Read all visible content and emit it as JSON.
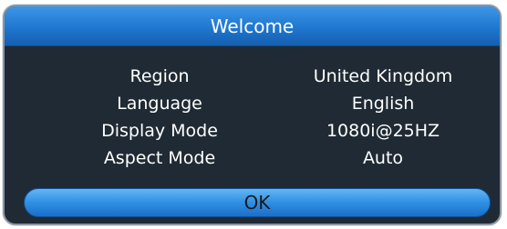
{
  "dialog": {
    "title": "Welcome",
    "settings": [
      {
        "label": "Region",
        "value": "United Kingdom"
      },
      {
        "label": "Language",
        "value": "English"
      },
      {
        "label": "Display Mode",
        "value": "1080i@25HZ"
      },
      {
        "label": "Aspect Mode",
        "value": "Auto"
      }
    ],
    "ok_label": "OK"
  },
  "colors": {
    "title_bar": "#1f77cf",
    "panel_background": "#1f2a34",
    "button_highlight": "#2f8fe3",
    "text": "#ffffff"
  }
}
